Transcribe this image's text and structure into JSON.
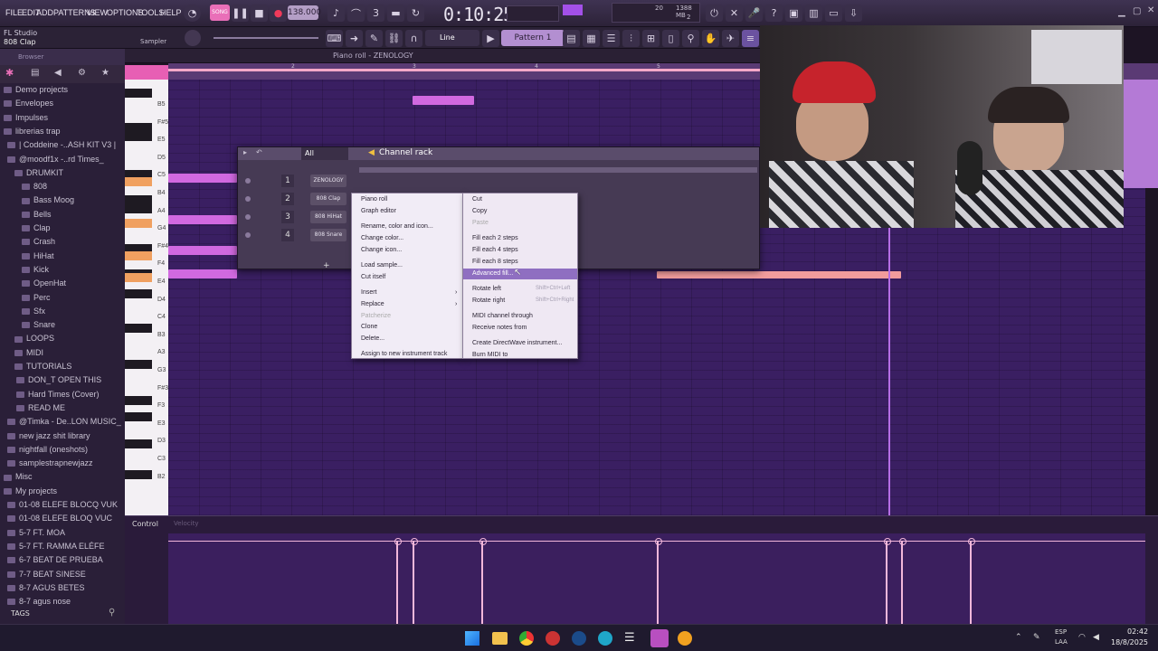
{
  "menu": [
    "FILE",
    "EDIT",
    "ADD",
    "PATTERNS",
    "VIEW",
    "OPTIONS",
    "TOOLS",
    "HELP"
  ],
  "transport": {
    "time": "0:10:25",
    "bpm": "138.000",
    "mode": "SONG",
    "pattern": "Pattern 1",
    "snap": "Line",
    "cpu": "20",
    "mem": "1388 MB",
    "poly": "2"
  },
  "hint": {
    "app": "FL Studio",
    "channel": "808 Clap",
    "sampler": "Sampler"
  },
  "browser": {
    "title": "Browser",
    "items": [
      "Demo projects",
      "Envelopes",
      "Impulses",
      "librerias trap",
      "| Coddeine -..ASH KIT V3 |",
      "@moodf1x -..rd Times_",
      "DRUMKIT",
      "808",
      "Bass Moog",
      "Bells",
      "Clap",
      "Crash",
      "HiHat",
      "Kick",
      "OpenHat",
      "Perc",
      "Sfx",
      "Snare",
      "LOOPS",
      "MIDI",
      "TUTORIALS",
      "DON_T OPEN THIS",
      "Hard Times (Cover)",
      "READ ME",
      "@Timka - De..LON MUSIC_",
      "new jazz shit library",
      "nightfall (oneshots)",
      "samplestrapnewjazz",
      "Misc",
      "My projects",
      "01-08 ELEFE BLOCQ VUK",
      "01-08 ELEFE BLOQ VUC",
      "5-7 FT. MOA",
      "5-7 FT. RAMMA ELÉFE",
      "6-7 BEAT DE PRUEBA",
      "7-7 BEAT SINESE",
      "8-7 AGUS BETES",
      "8-7 agus nose"
    ],
    "tags": "TAGS"
  },
  "pianoroll": {
    "title": "Piano roll - ZENOLOGY",
    "keys": [
      "B5",
      "F#5",
      "E5",
      "D5",
      "C5",
      "B4",
      "A4",
      "G4",
      "F#4",
      "F4",
      "E4",
      "D4",
      "C4",
      "B3",
      "A3",
      "G3",
      "F#3",
      "F3",
      "E3",
      "D3",
      "C3",
      "B2"
    ],
    "bars": [
      "2",
      "3",
      "4",
      "5"
    ],
    "control": "Control",
    "velocity": "Velocity"
  },
  "rack": {
    "title": "Channel rack",
    "filter": "All",
    "channels": [
      {
        "n": "1",
        "name": "ZENOLOGY"
      },
      {
        "n": "2",
        "name": "808 Clap"
      },
      {
        "n": "3",
        "name": "808 HiHat"
      },
      {
        "n": "4",
        "name": "808 Snare"
      }
    ]
  },
  "ctx_left": [
    "Piano roll",
    "Graph editor",
    "Rename, color and icon...",
    "Change color...",
    "Change icon...",
    "Load sample...",
    "Cut itself",
    "Insert",
    "Replace",
    "Patcherize",
    "Clone",
    "Delete...",
    "Assign to new instrument track"
  ],
  "ctx_right": [
    {
      "l": "Cut",
      "s": ""
    },
    {
      "l": "Copy",
      "s": ""
    },
    {
      "l": "Paste",
      "s": ""
    },
    {
      "l": "Fill each 2 steps",
      "s": ""
    },
    {
      "l": "Fill each 4 steps",
      "s": ""
    },
    {
      "l": "Fill each 8 steps",
      "s": ""
    },
    {
      "l": "Advanced fill...",
      "s": ""
    },
    {
      "l": "Rotate left",
      "s": "Shift+Ctrl+Left"
    },
    {
      "l": "Rotate right",
      "s": "Shift+Ctrl+Right"
    },
    {
      "l": "MIDI channel through",
      "s": ""
    },
    {
      "l": "Receive notes from",
      "s": ""
    },
    {
      "l": "Create DirectWave instrument...",
      "s": ""
    },
    {
      "l": "Burn MIDI to",
      "s": ""
    }
  ],
  "clock": {
    "time": "02:42",
    "date": "18/8/2025",
    "lang": "ESP",
    "layout": "LAA"
  },
  "colors": {
    "accent": "#e96fb8",
    "grid": "#3a1f62",
    "note": "#d169e0"
  }
}
